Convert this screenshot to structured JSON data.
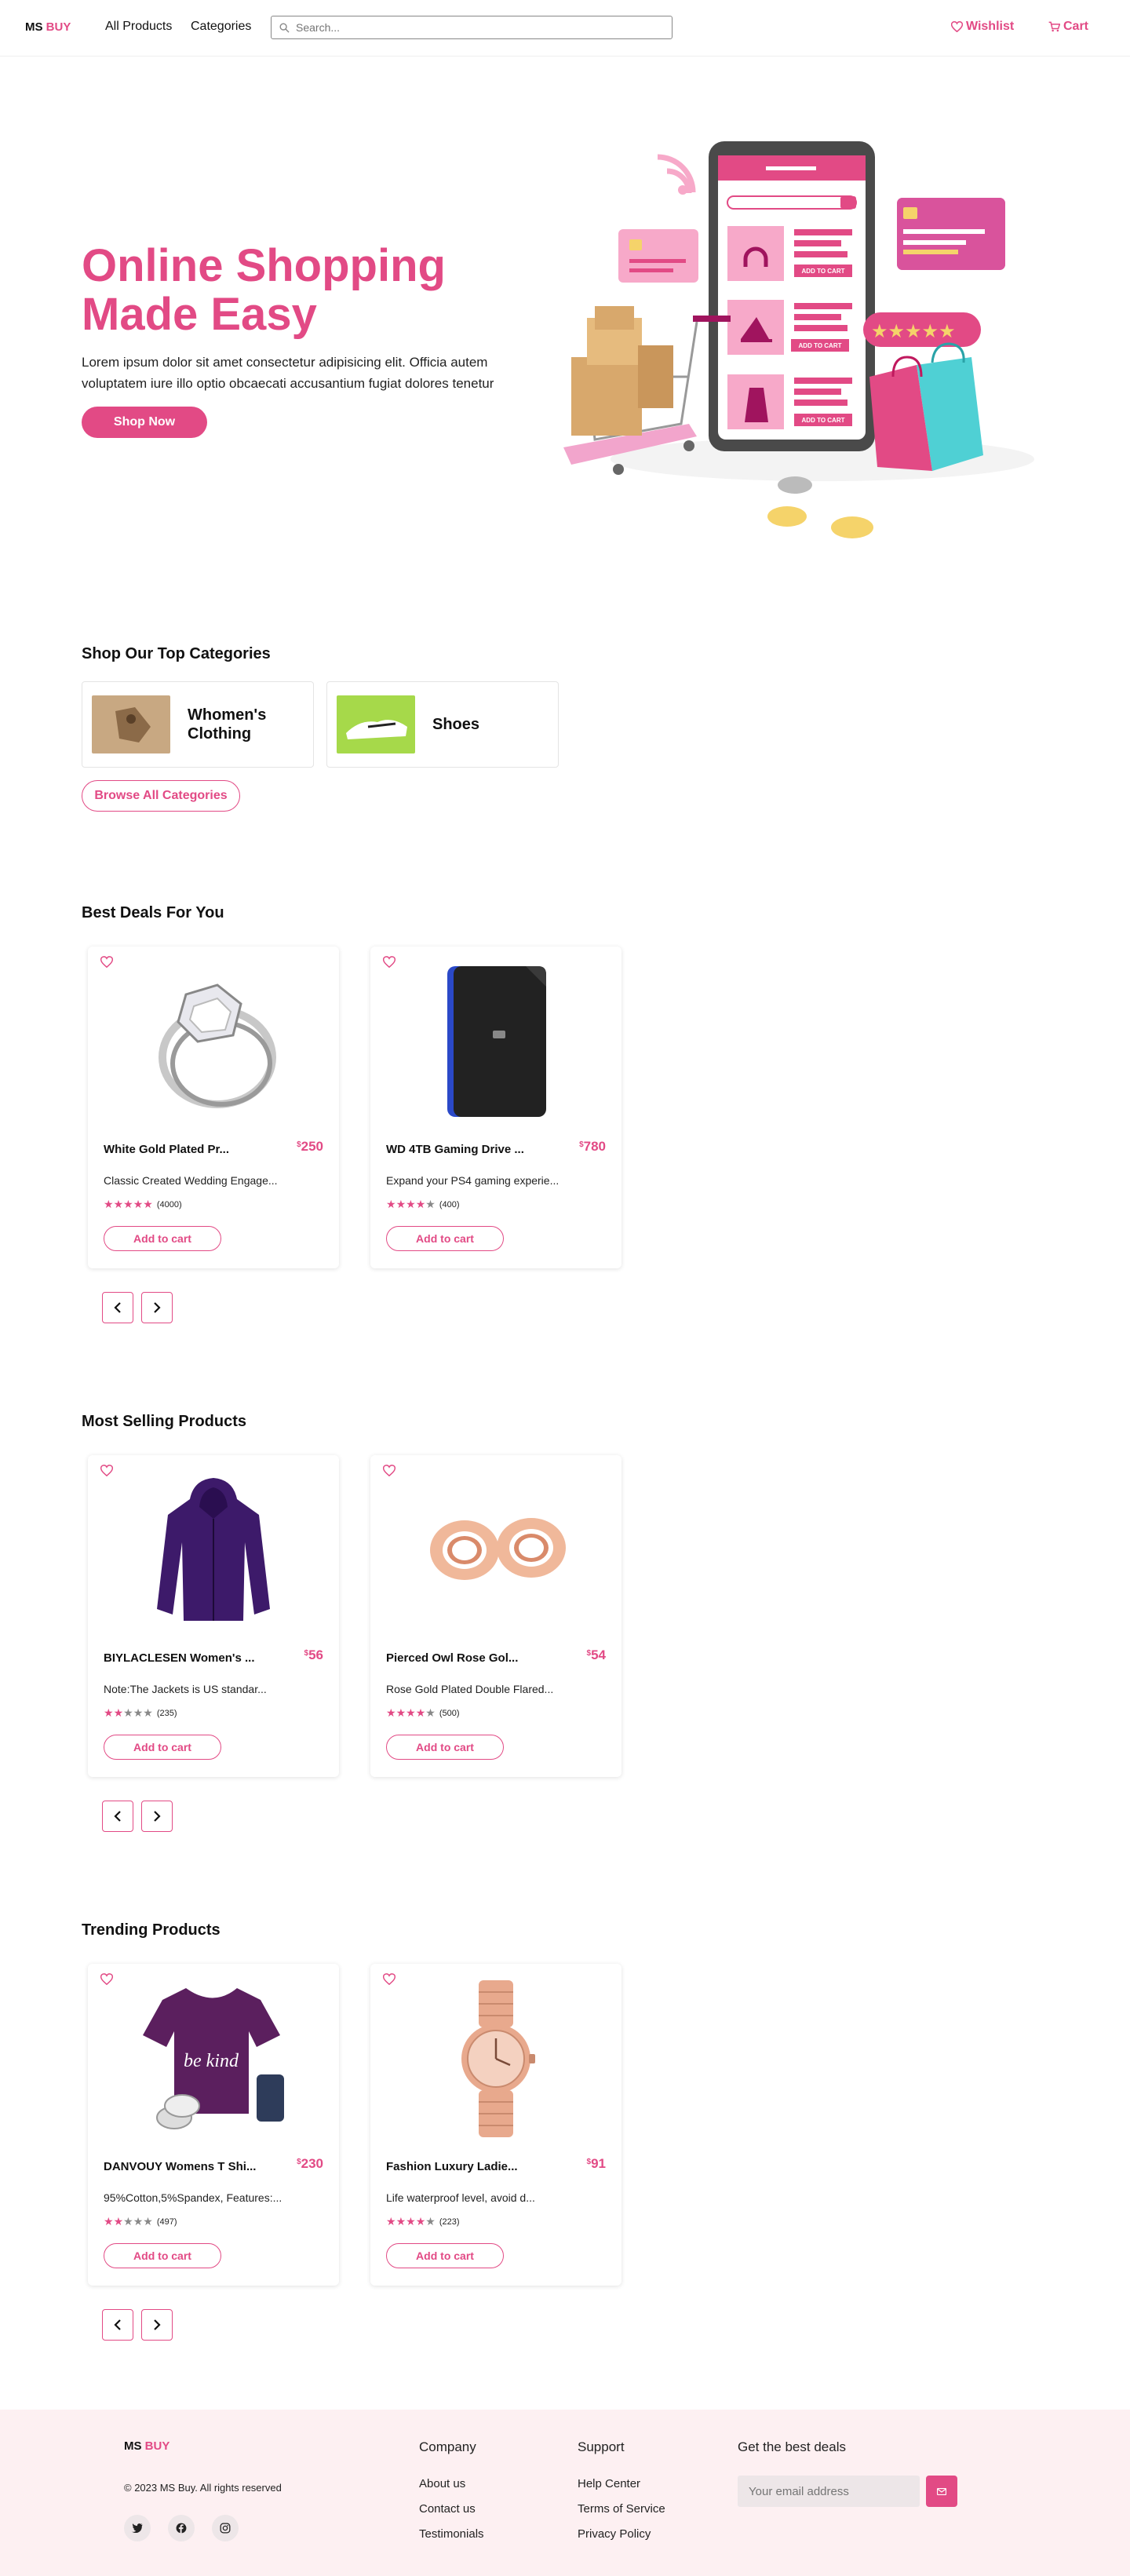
{
  "header": {
    "logo_ms": "MS",
    "logo_buy": "BUY",
    "nav": [
      "All Products",
      "Categories"
    ],
    "search_placeholder": "Search...",
    "wishlist": "Wishlist",
    "cart": "Cart"
  },
  "hero": {
    "title": "Online Shopping Made Easy",
    "text": "Lorem ipsum dolor sit amet consectetur adipisicing elit. Officia autem voluptatem iure illo optio obcaecati accusantium fugiat dolores tenetur",
    "button": "Shop Now",
    "illustration_labels": [
      "ADD TO CART",
      "ADD TO CART",
      "ADD TO CART"
    ]
  },
  "categories": {
    "heading": "Shop Our Top Categories",
    "items": [
      {
        "label": "Whomen's Clothing"
      },
      {
        "label": "Shoes"
      }
    ],
    "browse": "Browse All Categories"
  },
  "sections": [
    {
      "heading": "Best Deals For You",
      "products": [
        {
          "name": "White Gold Plated Pr...",
          "currency": "$",
          "price": "250",
          "desc": "Classic Created Wedding Engage...",
          "rating": 5,
          "count": "(4000)",
          "image": "ring-icon"
        },
        {
          "name": "WD 4TB Gaming Drive ...",
          "currency": "$",
          "price": "780",
          "desc": "Expand your PS4 gaming experie...",
          "rating": 4,
          "count": "(400)",
          "image": "hard-drive-icon"
        }
      ]
    },
    {
      "heading": "Most Selling Products",
      "products": [
        {
          "name": "BIYLACLESEN Women's ...",
          "currency": "$",
          "price": "56",
          "desc": "Note:The Jackets is US standar...",
          "rating": 2,
          "count": "(235)",
          "image": "jacket-icon"
        },
        {
          "name": "Pierced Owl Rose Gol...",
          "currency": "$",
          "price": "54",
          "desc": "Rose Gold Plated Double Flared...",
          "rating": 4,
          "count": "(500)",
          "image": "earrings-icon"
        }
      ]
    },
    {
      "heading": "Trending Products",
      "products": [
        {
          "name": "DANVOUY Womens T Shi...",
          "currency": "$",
          "price": "230",
          "desc": "95%Cotton,5%Spandex, Features:...",
          "rating": 2,
          "count": "(497)",
          "image": "tshirt-icon",
          "shirt_text": "be kind"
        },
        {
          "name": "Fashion Luxury Ladie...",
          "currency": "$",
          "price": "91",
          "desc": "Life waterproof level, avoid d...",
          "rating": 4,
          "count": "(223)",
          "image": "watch-icon"
        }
      ]
    }
  ],
  "add_to_cart": "Add to cart",
  "footer": {
    "logo_ms": "MS",
    "logo_buy": "BUY",
    "copyright": "© 2023 MS Buy. All rights reserved",
    "company_heading": "Company",
    "company_links": [
      "About us",
      "Contact us",
      "Testimonials"
    ],
    "support_heading": "Support",
    "support_links": [
      "Help Center",
      "Terms of Service",
      "Privacy Policy"
    ],
    "deals_heading": "Get the best deals",
    "email_placeholder": "Your email address",
    "social": [
      "twitter-icon",
      "facebook-icon",
      "instagram-icon"
    ]
  },
  "colors": {
    "accent": "#e24a85",
    "footer_bg": "#fdf0f2"
  }
}
